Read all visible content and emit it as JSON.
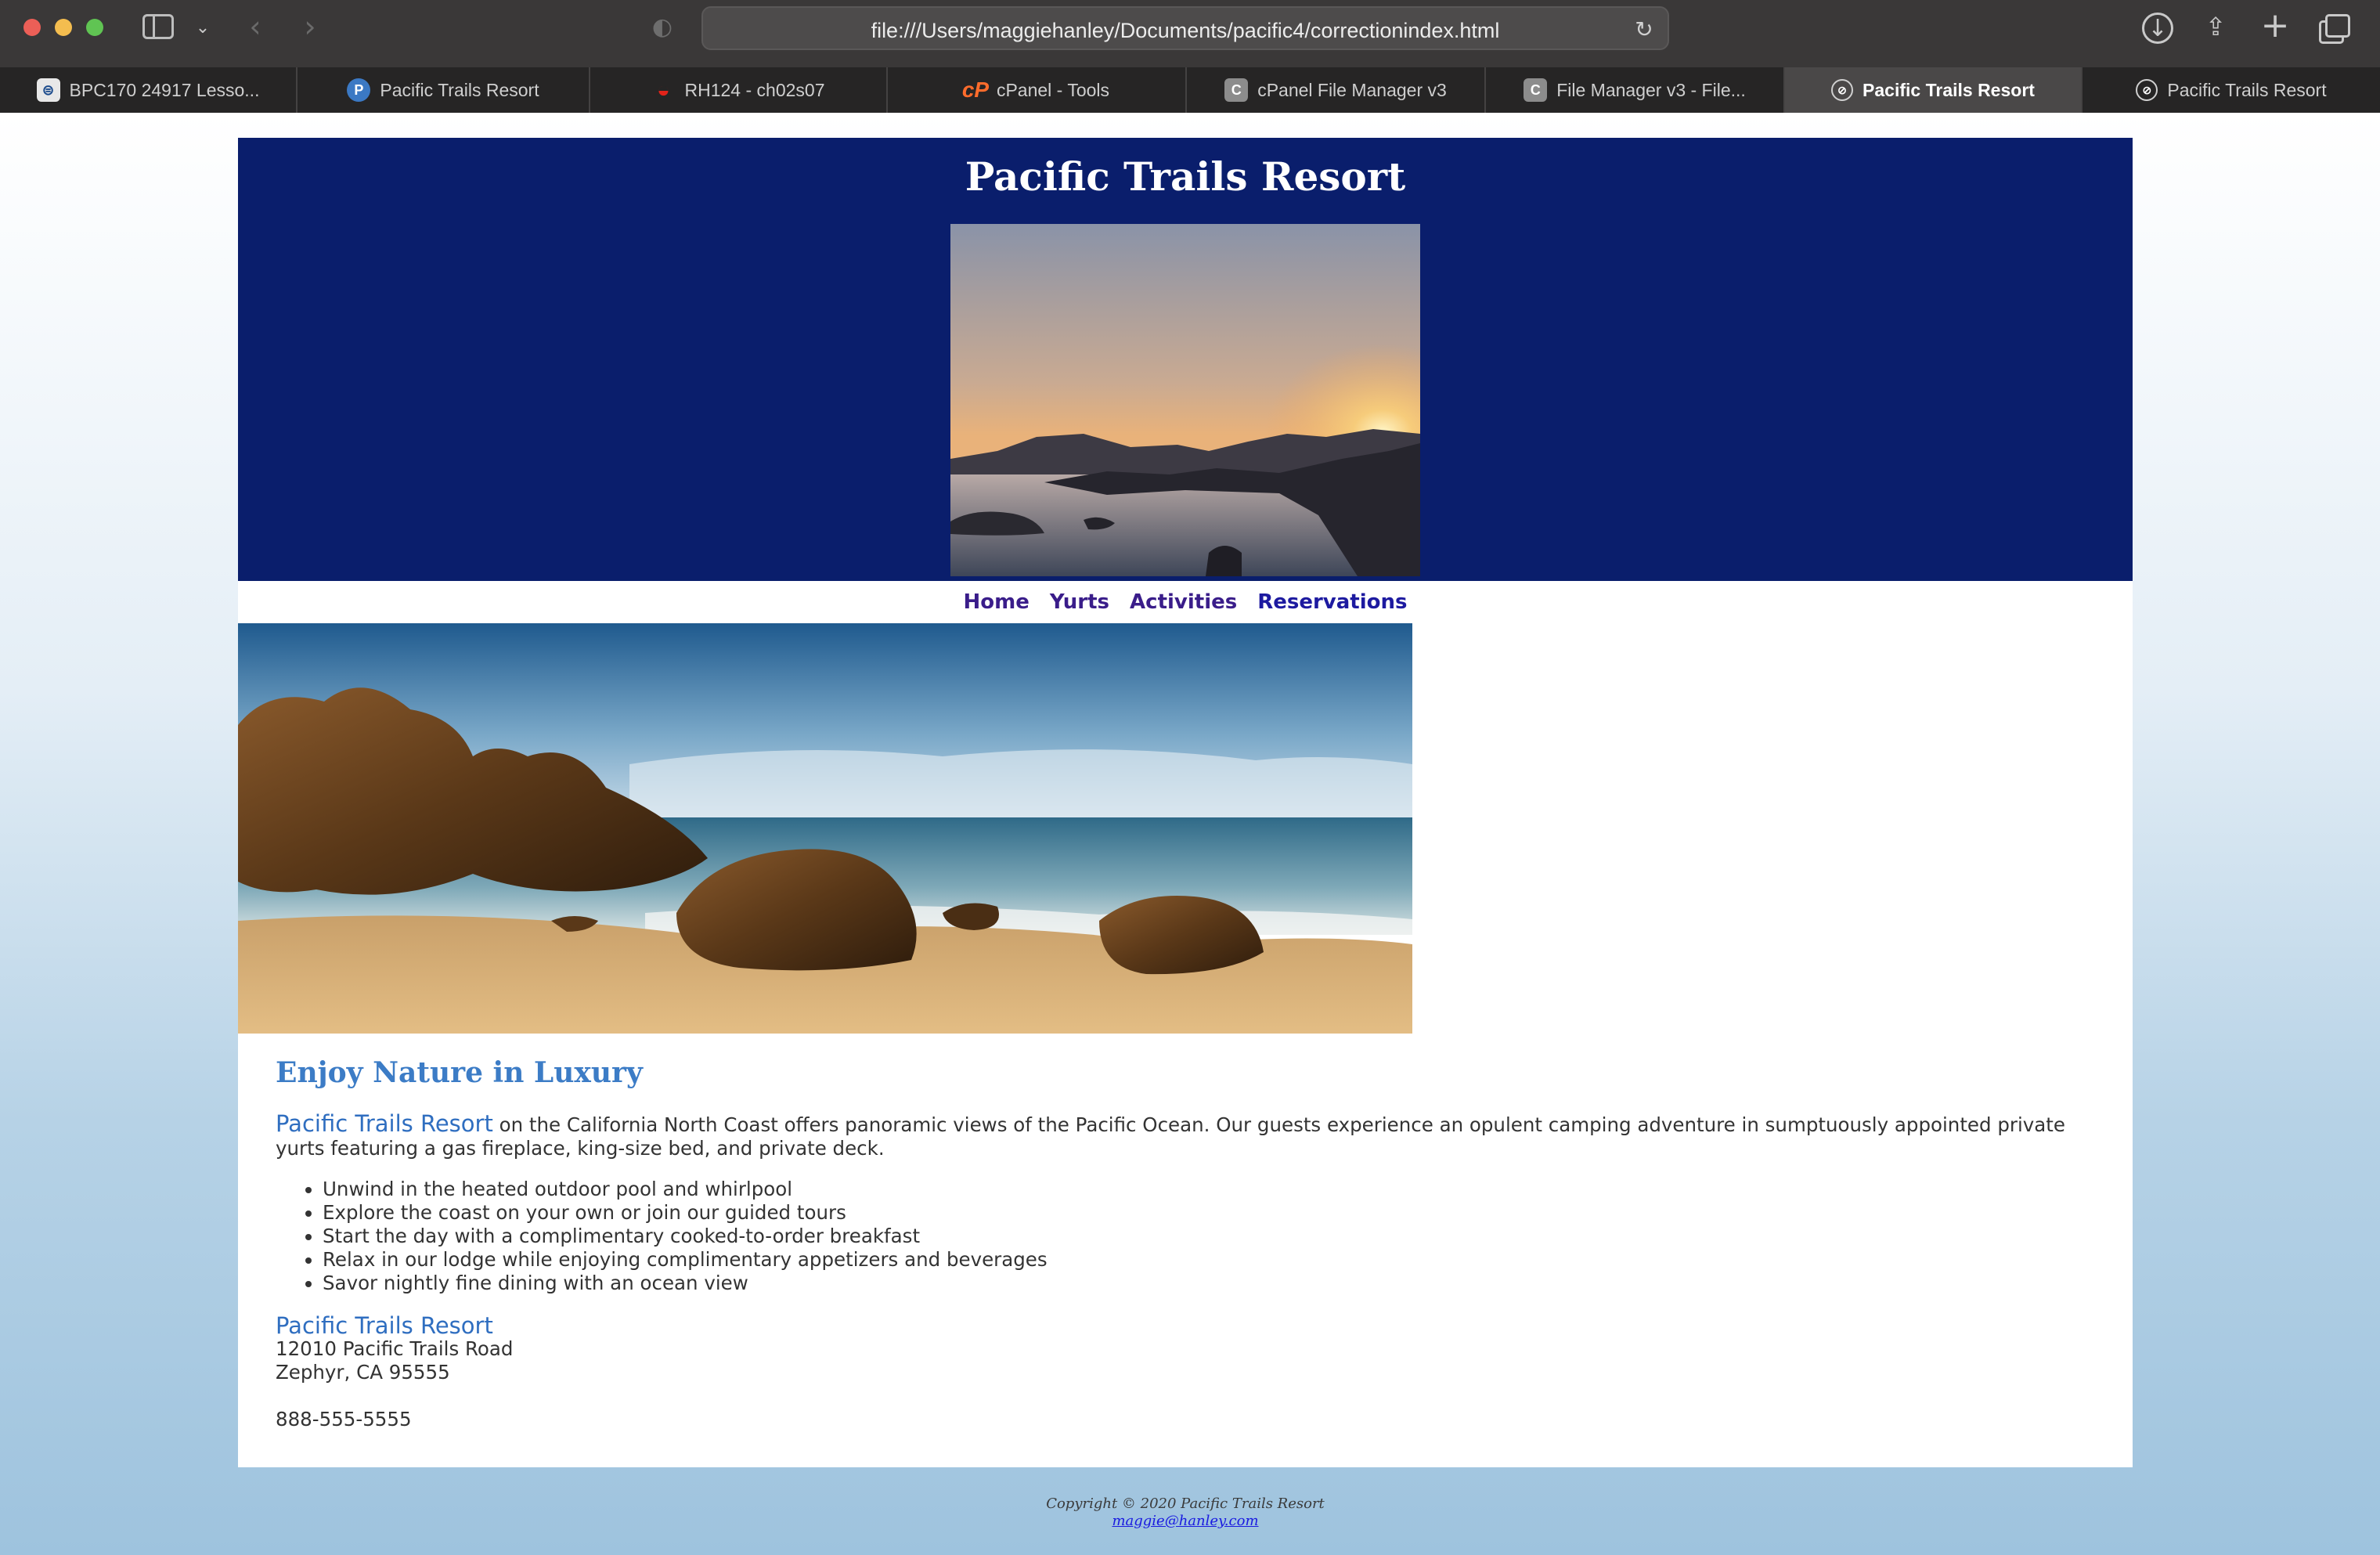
{
  "browser": {
    "url": "file:///Users/maggiehanley/Documents/pacific4/correctionindex.html",
    "tabs": [
      {
        "label": "BPC170 24917 Lesso...",
        "icon": "bpc-icon",
        "active": false
      },
      {
        "label": "Pacific Trails Resort",
        "icon": "pearson-icon",
        "active": false
      },
      {
        "label": "RH124 - ch02s07",
        "icon": "redhat-icon",
        "active": false
      },
      {
        "label": "cPanel - Tools",
        "icon": "cpanel-icon",
        "active": false
      },
      {
        "label": "cPanel File Manager v3",
        "icon": "c-icon",
        "active": false
      },
      {
        "label": "File Manager v3 - File...",
        "icon": "c-icon",
        "active": false
      },
      {
        "label": "Pacific Trails Resort",
        "icon": "compass-icon",
        "active": true
      },
      {
        "label": "Pacific Trails Resort",
        "icon": "compass-icon",
        "active": false
      }
    ]
  },
  "site": {
    "title": "Pacific Trails Resort",
    "nav": [
      "Home",
      "Yurts",
      "Activities",
      "Reservations"
    ],
    "heading": "Enjoy Nature in Luxury",
    "intro_name": "Pacific Trails Resort",
    "intro_text": " on the California North Coast offers panoramic views of the Pacific Ocean. Our guests experience an opulent camping adventure in sumptuously appointed private yurts featuring a gas fireplace, king-size bed, and private deck.",
    "amenities": [
      "Unwind in the heated outdoor pool and whirlpool",
      "Explore the coast on your own or join our guided tours",
      "Start the day with a complimentary cooked-to-order breakfast",
      "Relax in our lodge while enjoying complimentary appetizers and beverages",
      "Savor nightly fine dining with an ocean view"
    ],
    "contact": {
      "name": "Pacific Trails Resort",
      "street": "12010 Pacific Trails Road",
      "city": "Zephyr, CA 95555",
      "phone": "888-555-5555"
    },
    "footer": {
      "copyright": "Copyright © 2020 Pacific Trails Resort",
      "email": "maggie@hanley.com"
    }
  },
  "colors": {
    "header_bg": "#0a1e6c",
    "heading": "#3c7cc6",
    "nav_link": "#3a1d8a",
    "link_blue": "#2f6ec0"
  }
}
